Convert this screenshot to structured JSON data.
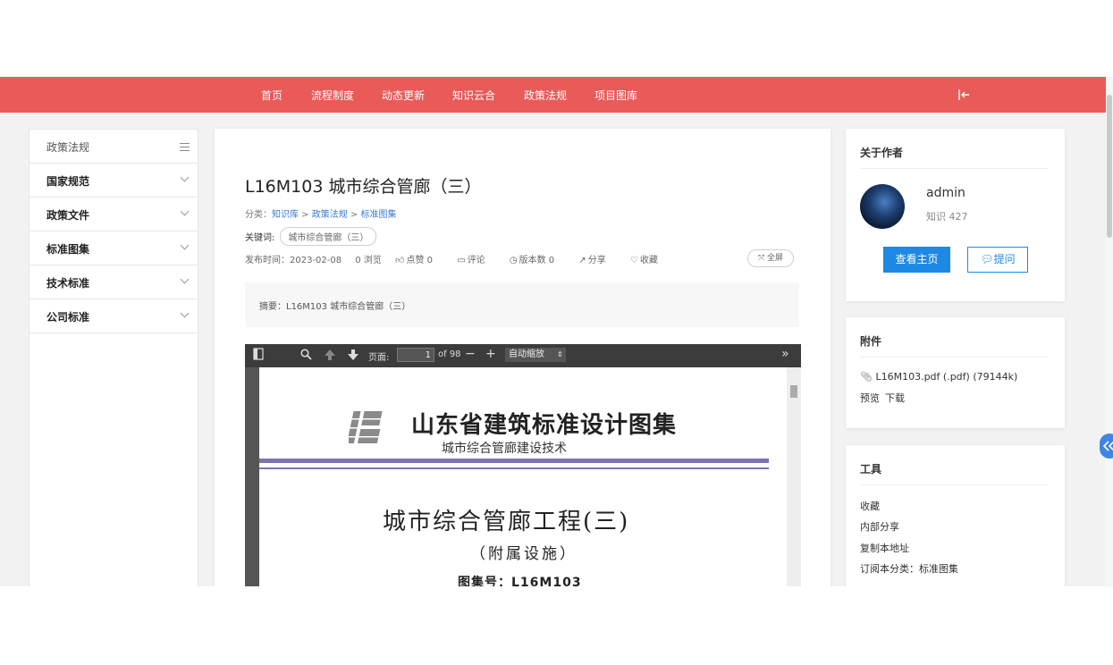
{
  "nav": {
    "items": [
      "首页",
      "流程制度",
      "动态更新",
      "知识云合",
      "政策法规",
      "项目图库"
    ],
    "accent_color": "#e85b58",
    "logout_icon": "logout-icon"
  },
  "sidebar": {
    "header": "政策法规",
    "items": [
      "国家规范",
      "政策文件",
      "标准图集",
      "技术标准",
      "公司标准"
    ]
  },
  "article": {
    "title": "L16M103 城市综合管廊（三）",
    "breadcrumb": {
      "label": "分类：",
      "items": [
        "知识库",
        "政策法规",
        "标准图集"
      ],
      "separator": " > "
    },
    "keywords": {
      "label": "关键词:",
      "tag": "城市综合管廊（三）"
    },
    "meta": {
      "publish": "发布时间：2023-02-08",
      "views": "0 浏览",
      "likes": "点赞 0",
      "comments": "评论",
      "versions": "版本数 0",
      "share": "分享",
      "favorite": "收藏"
    },
    "fullscreen": "全屏",
    "abstract": "摘要：L16M103 城市综合管廊（三）"
  },
  "pdf_viewer": {
    "page_label": "页面:",
    "page_current": "1",
    "page_total": "of 98",
    "zoom": "自动缩放",
    "doc": {
      "header_line1": "山东省建筑标准设计图集",
      "header_line2": "城市综合管廊建设技术",
      "title": "城市综合管廊工程(三)",
      "subtitle": "（附属设施）",
      "number": "图集号：L16M103"
    }
  },
  "author_card": {
    "title": "关于作者",
    "name": "admin",
    "stat": "知识 427",
    "home_button": "查看主页",
    "ask_button": "提问",
    "primary_color": "#1e88e5"
  },
  "attachment_card": {
    "title": "附件",
    "file": "L16M103.pdf (.pdf) (79144k)",
    "preview": "预览",
    "download": "下载"
  },
  "tools_card": {
    "title": "工具",
    "items": [
      "收藏",
      "内部分享",
      "复制本地址",
      "订阅本分类：标准图集"
    ]
  }
}
